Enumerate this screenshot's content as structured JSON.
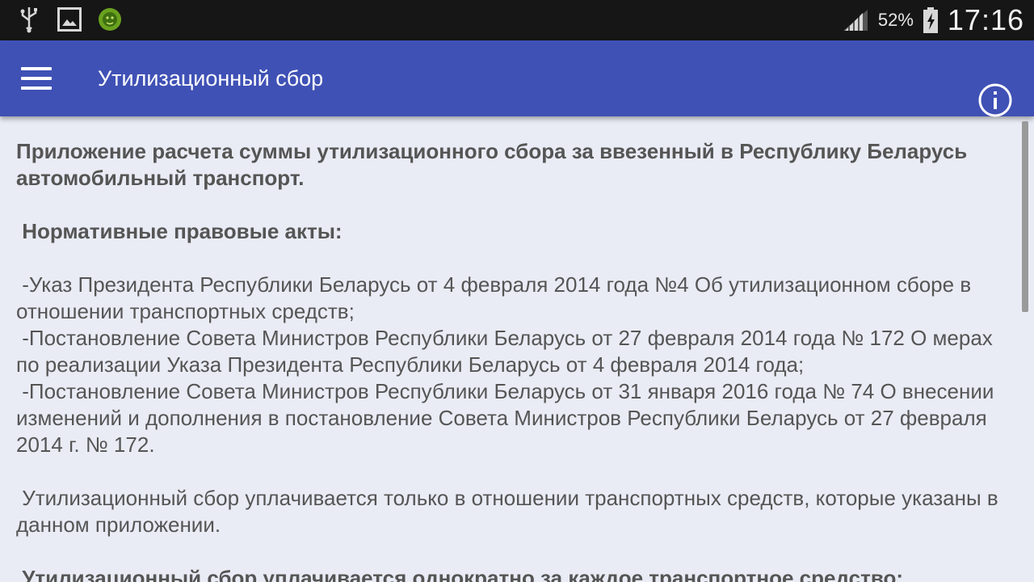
{
  "status_bar": {
    "icons": [
      "usb-icon",
      "image-icon",
      "app-lion-icon"
    ],
    "battery_percent": "52%",
    "time": "17:16"
  },
  "app_bar": {
    "title": "Утилизационный сбор",
    "menu_icon": "hamburger-menu-icon",
    "info_icon": "info-icon",
    "color": "#3f51b5"
  },
  "content": {
    "intro": "Приложение расчета суммы утилизационного сбора за ввезенный в Республику Беларусь автомобильный транспорт.",
    "acts_heading": " Нормативные правовые акты:",
    "act1": " -Указ Президента Республики Беларусь от 4 февраля 2014 года №4 Об утилизационном сборе в отношении транспортных средств;",
    "act2": " -Постановление Совета Министров Республики Беларусь от 27 февраля 2014 года № 172 О мерах по реализации Указа Президента Республики Беларусь от 4 февраля 2014 года;",
    "act3": " -Постановление Совета Министров Республики Беларусь от 31 января 2016 года № 74 О внесении изменений и дополнения в постановление Совета Министров Республики Беларусь от 27 февраля 2014 г. № 172.",
    "note1": " Утилизационный сбор уплачивается только в отношении транспортных средств, которые указаны в данном приложении.",
    "note2": " Утилизационный сбор уплачивается однократно за каждое транспортное средство:"
  }
}
